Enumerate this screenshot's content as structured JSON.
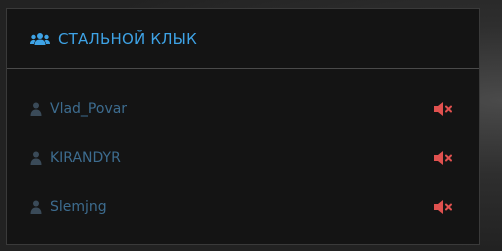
{
  "panel": {
    "title": "СТАЛЬНОЙ КЛЫК",
    "title_icon": "group-icon",
    "accent_color": "#3ea3e6",
    "members": [
      {
        "name": "Vlad_Povar",
        "icon": "user-icon",
        "mute_icon": "speaker-muted-icon"
      },
      {
        "name": "KIRANDYR",
        "icon": "user-icon",
        "mute_icon": "speaker-muted-icon"
      },
      {
        "name": "Slemjng",
        "icon": "user-icon",
        "mute_icon": "speaker-muted-icon"
      }
    ],
    "name_color": "#3d6c8f",
    "mute_color": "#e0514f"
  }
}
